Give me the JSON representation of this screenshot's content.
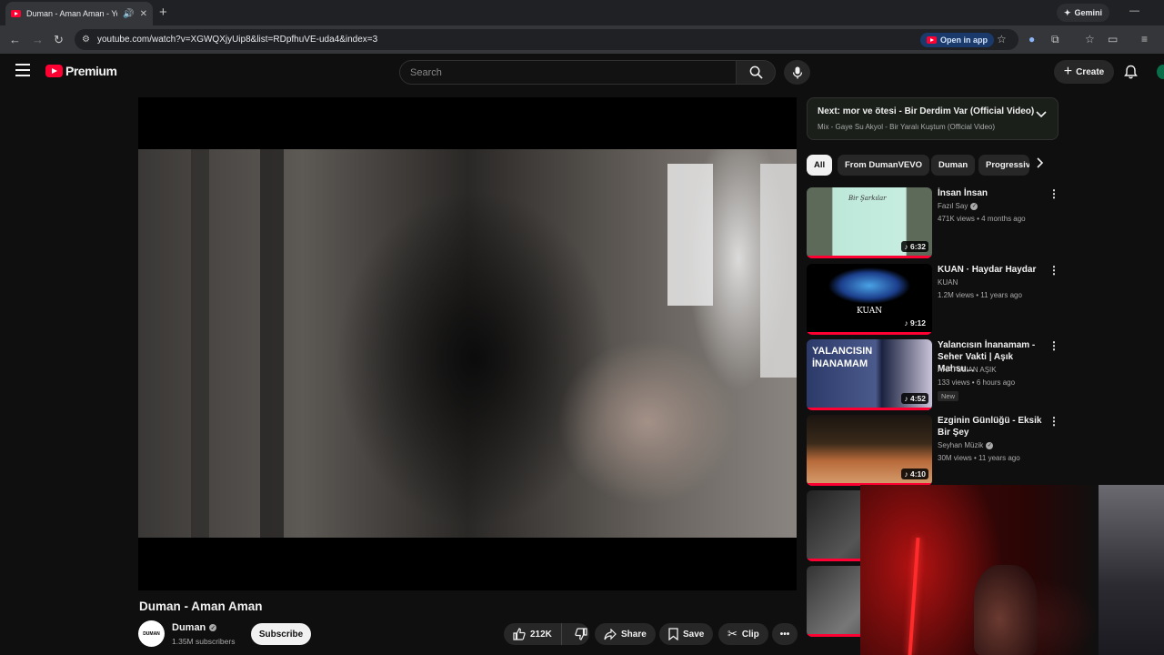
{
  "browser": {
    "tab_title": "Duman - Aman Aman - You",
    "gemini_label": "Gemini",
    "url": "youtube.com/watch?v=XGWQXjyUip8&list=RDpfhuVE-uda4&index=3",
    "open_in_app_label": "Open in app"
  },
  "header": {
    "logo_text": "Premium",
    "search_placeholder": "Search",
    "create_label": "Create"
  },
  "video": {
    "title": "Duman - Aman Aman",
    "channel_name": "Duman",
    "channel_avatar_text": "DUMAN",
    "subscribers": "1.35M subscribers",
    "subscribe_label": "Subscribe",
    "likes": "212K",
    "share_label": "Share",
    "save_label": "Save",
    "clip_label": "Clip"
  },
  "up_next": {
    "title": "Next: mor ve ötesi - Bir Derdim Var (Official Video)",
    "subtitle": "Mix - Gaye Su Akyol - Bir Yaralı Kuştum (Official Video)"
  },
  "chips": [
    "All",
    "From DumanVEVO",
    "Duman",
    "Progressive"
  ],
  "recommendations": [
    {
      "title": "İnsan İnsan",
      "channel": "Fazıl Say",
      "verified": true,
      "meta": "471K views • 4 months ago",
      "duration": "6:32",
      "thumb_text": "Bir Şarkılar",
      "new": ""
    },
    {
      "title": "KUAN · Haydar Haydar",
      "channel": "KUAN",
      "verified": false,
      "meta": "1.2M views • 11 years ago",
      "duration": "9:12",
      "thumb_text": "KUAN",
      "new": ""
    },
    {
      "title": "Yalancısın İnanamam - Seher Vakti | Aşık Mahsu...",
      "channel": "ANATOLIAN AŞIK",
      "verified": false,
      "meta": "133 views • 6 hours ago",
      "duration": "4:52",
      "thumb_text": "YALANCISIN İNANAMAM",
      "new": "New"
    },
    {
      "title": "Ezginin Günlüğü - Eksik Bir Şey",
      "channel": "Seyhan Müzik",
      "verified": true,
      "meta": "30M views • 11 years ago",
      "duration": "4:10",
      "thumb_text": "",
      "new": ""
    }
  ],
  "icons": {
    "music_note": "♪",
    "verified": "✓",
    "more": "⋮"
  },
  "colors": {
    "youtube_red": "#ff0033",
    "background": "#0f0f0f"
  }
}
